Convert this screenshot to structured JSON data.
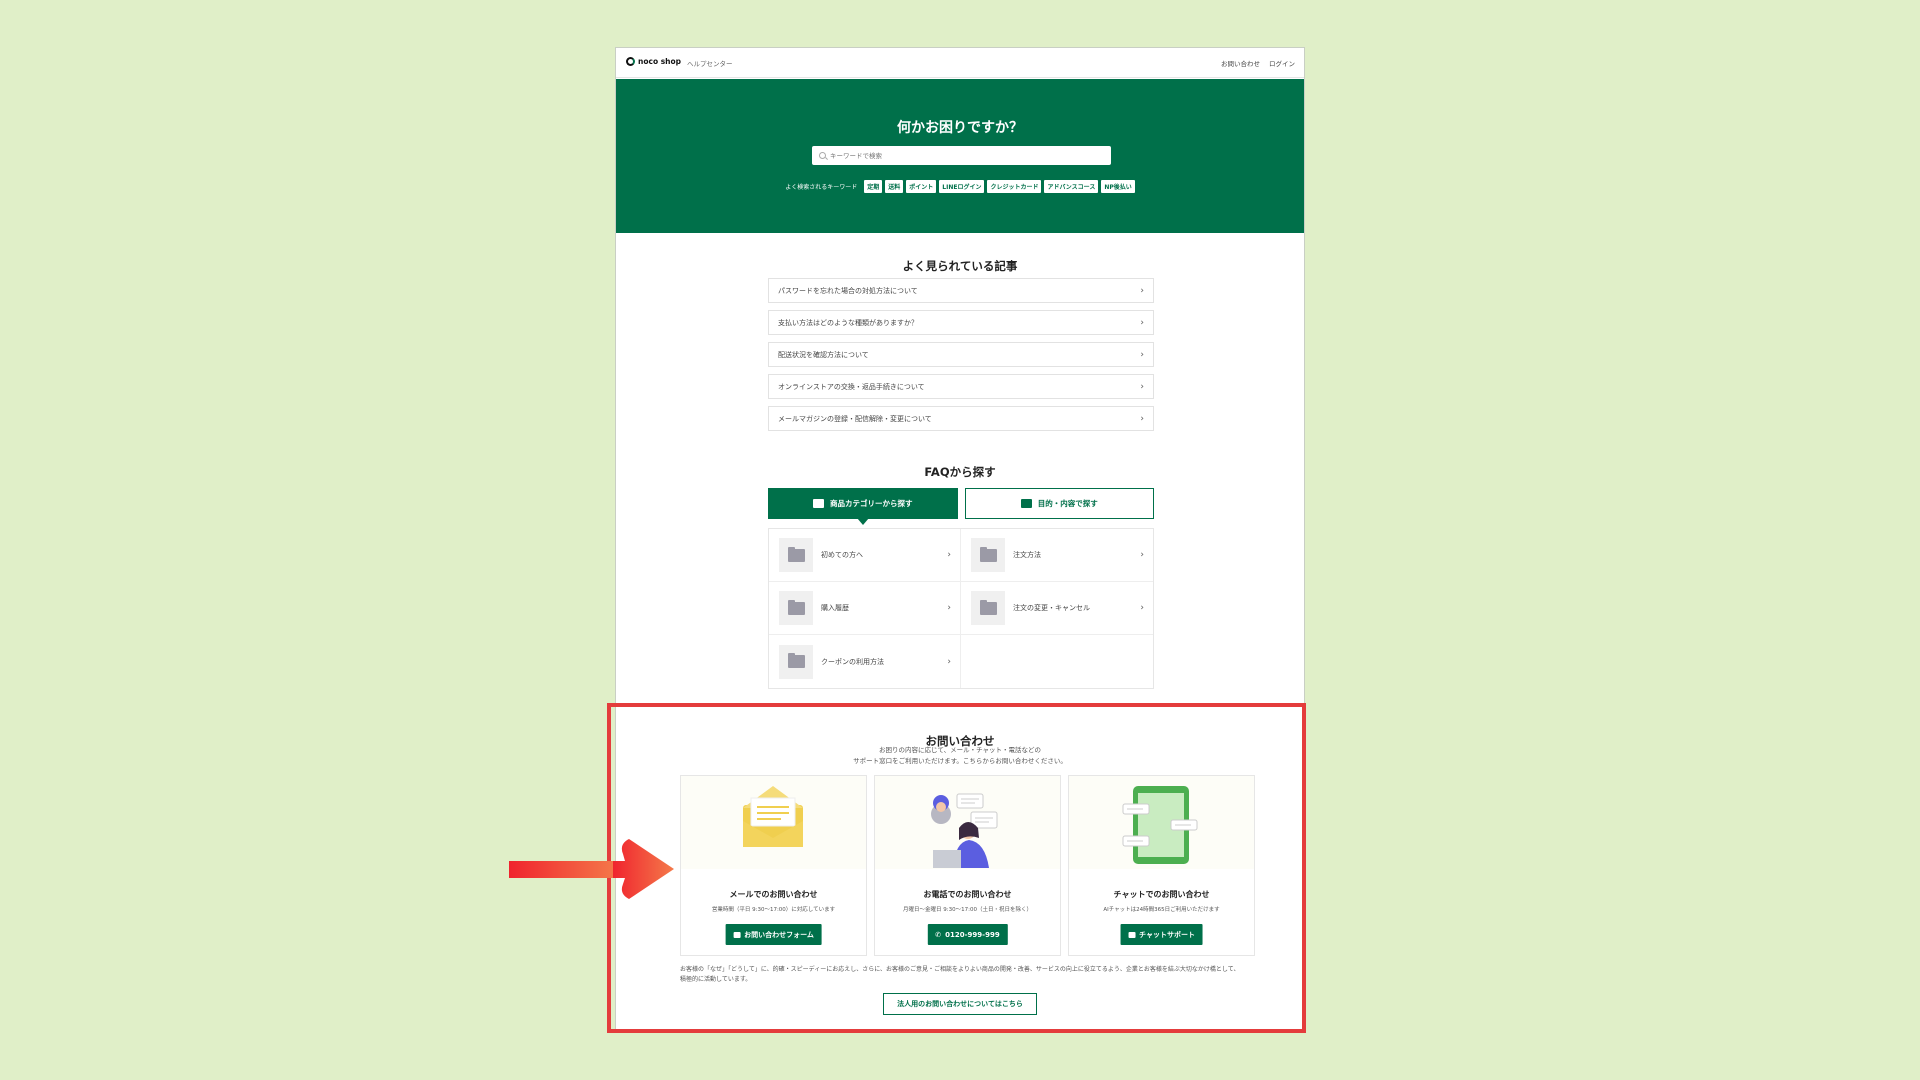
{
  "header": {
    "logo_text": "noco shop",
    "sub_label": "ヘルプセンター",
    "links": [
      "お問い合わせ",
      "ログイン"
    ]
  },
  "hero": {
    "title": "何かお困りですか？",
    "search_placeholder": "キーワードで検索",
    "keywords_label": "よく検索されるキーワード",
    "keywords": [
      "定期",
      "送料",
      "ポイント",
      "LINEログイン",
      "クレジットカード",
      "アドバンスコース",
      "NP後払い"
    ]
  },
  "popular": {
    "title": "よく見られている記事",
    "articles": [
      "パスワードを忘れた場合の対処方法について",
      "支払い方法はどのような種類がありますか？",
      "配送状況を確認方法について",
      "オンラインストアの交換・返品手続きについて",
      "メールマガジンの登録・配信解除・変更について"
    ]
  },
  "faq": {
    "title": "FAQから探す",
    "tabs": [
      "商品カテゴリーから探す",
      "目的・内容で探す"
    ],
    "categories": [
      "初めての方へ",
      "注文方法",
      "購入履歴",
      "注文の変更・キャンセル",
      "クーポンの利用方法"
    ]
  },
  "contact": {
    "title": "お問い合わせ",
    "desc_line1": "お困りの内容に応じて、メール・チャット・電話などの",
    "desc_line2": "サポート窓口をご利用いただけます。こちらからお問い合わせください。",
    "cards": [
      {
        "title": "メールでのお問い合わせ",
        "sub": "営業時間（平日 9:30〜17:00）に対応しています",
        "button": "お問い合わせフォーム",
        "icon": "envelope-icon"
      },
      {
        "title": "お電話でのお問い合わせ",
        "sub": "月曜日〜金曜日 9:30〜17:00（土日・祝日を除く）",
        "button": "0120-999-999",
        "icon": "phone-icon"
      },
      {
        "title": "チャットでのお問い合わせ",
        "sub": "AIチャットは24時間365日ご利用いただけます",
        "button": "チャットサポート",
        "icon": "chat-icon"
      }
    ],
    "footnote": "お客様の「なぜ」「どうして」に、的確・スピーディーにお応えし、さらに、お客様のご意見・ご相談をよりよい商品の開発・改善、サービスの向上に役立てるよう、企業とお客様を結ぶ大切なかけ橋として、積極的に活動しています。",
    "corporate_button": "法人用のお問い合わせについてはこちら"
  },
  "colors": {
    "background": "#e0efc8",
    "brand_green": "#00704a",
    "highlight_red": "#e43c3c",
    "arrow": "#f04e2f"
  }
}
